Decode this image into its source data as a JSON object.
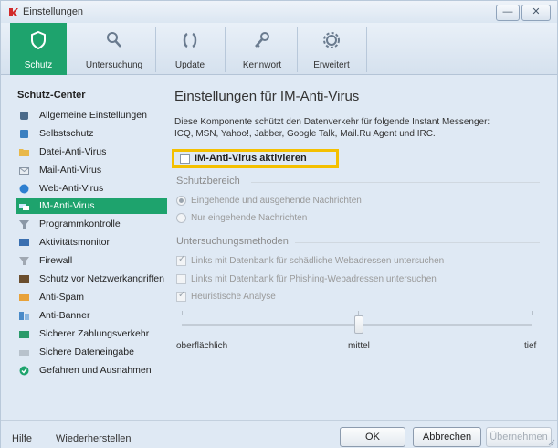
{
  "window": {
    "title": "Einstellungen"
  },
  "toolbar": {
    "tabs": [
      {
        "label": "Schutz",
        "icon": "shield-icon",
        "active": true
      },
      {
        "label": "Untersuchung",
        "icon": "magnifier-icon",
        "active": false
      },
      {
        "label": "Update",
        "icon": "refresh-icon",
        "active": false
      },
      {
        "label": "Kennwort",
        "icon": "key-icon",
        "active": false
      },
      {
        "label": "Erweitert",
        "icon": "gear-icon",
        "active": false
      }
    ]
  },
  "sidebar": {
    "header": "Schutz-Center",
    "items": [
      {
        "label": "Allgemeine Einstellungen",
        "icon": "settings-icon"
      },
      {
        "label": "Selbstschutz",
        "icon": "self-protection-icon"
      },
      {
        "label": "Datei-Anti-Virus",
        "icon": "folder-icon"
      },
      {
        "label": "Mail-Anti-Virus",
        "icon": "mail-icon"
      },
      {
        "label": "Web-Anti-Virus",
        "icon": "globe-icon"
      },
      {
        "label": "IM-Anti-Virus",
        "icon": "chat-icon",
        "selected": true
      },
      {
        "label": "Programmkontrolle",
        "icon": "funnel-icon"
      },
      {
        "label": "Aktivitätsmonitor",
        "icon": "monitor-icon"
      },
      {
        "label": "Firewall",
        "icon": "firewall-icon"
      },
      {
        "label": "Schutz vor Netzwerkangriffen",
        "icon": "network-attack-icon"
      },
      {
        "label": "Anti-Spam",
        "icon": "anti-spam-icon"
      },
      {
        "label": "Anti-Banner",
        "icon": "anti-banner-icon"
      },
      {
        "label": "Sicherer Zahlungsverkehr",
        "icon": "card-icon"
      },
      {
        "label": "Sichere Dateneingabe",
        "icon": "keyboard-icon"
      },
      {
        "label": "Gefahren und Ausnahmen",
        "icon": "check-circle-icon"
      }
    ]
  },
  "main": {
    "title": "Einstellungen für IM-Anti-Virus",
    "description_line1": "Diese Komponente schützt den Datenverkehr für folgende Instant Messenger:",
    "description_line2": "ICQ, MSN, Yahoo!, Jabber, Google Talk, Mail.Ru Agent und IRC.",
    "enable_label": "IM-Anti-Virus aktivieren",
    "enable_checked": false,
    "scope": {
      "header": "Schutzbereich",
      "options": [
        {
          "label": "Eingehende und ausgehende Nachrichten",
          "selected": true
        },
        {
          "label": "Nur eingehende Nachrichten",
          "selected": false
        }
      ]
    },
    "methods": {
      "header": "Untersuchungsmethoden",
      "options": [
        {
          "label": "Links mit Datenbank für schädliche Webadressen untersuchen",
          "checked": true
        },
        {
          "label": "Links mit Datenbank für Phishing-Webadressen untersuchen",
          "checked": false
        },
        {
          "label": "Heuristische Analyse",
          "checked": true
        }
      ]
    },
    "slider": {
      "min_label": "oberflächlich",
      "mid_label": "mittel",
      "max_label": "tief",
      "value": 0.5
    }
  },
  "footer": {
    "help": "Hilfe",
    "restore": "Wiederherstellen",
    "ok": "OK",
    "cancel": "Abbrechen",
    "apply": "Übernehmen"
  },
  "colors": {
    "accent": "#1ea36d",
    "highlight_border": "#f4c000"
  }
}
